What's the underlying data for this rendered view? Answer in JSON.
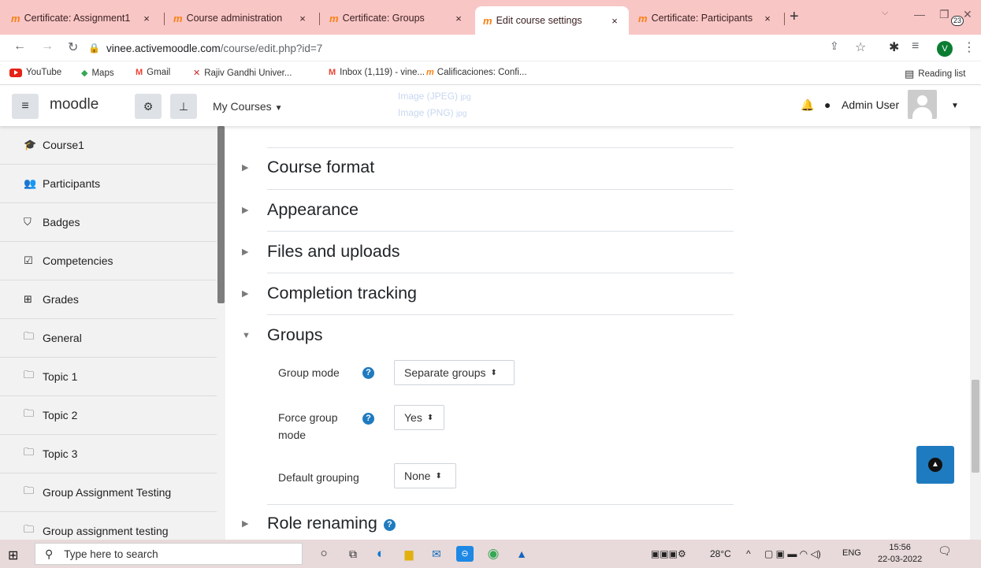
{
  "browser": {
    "tabs": [
      {
        "title": "Certificate: Assignment1"
      },
      {
        "title": "Course administration"
      },
      {
        "title": "Certificate: Groups"
      },
      {
        "title": "Edit course settings"
      },
      {
        "title": "Certificate: Participants"
      }
    ],
    "tab_close": "×",
    "new_tab": "+",
    "window": {
      "minimize": "—",
      "restore": "❐",
      "close": "✕"
    },
    "url_host": "vinee.activemoodle.com",
    "url_path": "/course/edit.php?id=7",
    "profile_initial": "V",
    "bookmarks": [
      "YouTube",
      "Maps",
      "Gmail",
      "Rajiv Gandhi Univer...",
      "Inbox (1,119) - vine...",
      "Calificaciones: Confi..."
    ],
    "reading_list": "Reading list"
  },
  "navbar": {
    "brand": "moodle",
    "my_courses": "My Courses",
    "user": "Admin User",
    "ghost_lines": [
      "Image (JPEG)",
      "Image (PNG)"
    ],
    "ghost_suffix": "jpg"
  },
  "drawer": {
    "items": [
      {
        "label": "Course1",
        "icon": "graduation-cap-icon"
      },
      {
        "label": "Participants",
        "icon": "users-icon"
      },
      {
        "label": "Badges",
        "icon": "shield-icon"
      },
      {
        "label": "Competencies",
        "icon": "checkbox-icon"
      },
      {
        "label": "Grades",
        "icon": "table-icon"
      },
      {
        "label": "General",
        "icon": "folder-icon"
      },
      {
        "label": "Topic 1",
        "icon": "folder-icon"
      },
      {
        "label": "Topic 2",
        "icon": "folder-icon"
      },
      {
        "label": "Topic 3",
        "icon": "folder-icon"
      },
      {
        "label": "Group Assignment Testing",
        "icon": "folder-icon"
      },
      {
        "label": "Group assignment testing",
        "icon": "folder-icon"
      }
    ]
  },
  "form": {
    "sections": {
      "course_format": "Course format",
      "appearance": "Appearance",
      "files": "Files and uploads",
      "completion": "Completion tracking",
      "groups": "Groups",
      "role_renaming": "Role renaming"
    },
    "groups": {
      "group_mode_label": "Group mode",
      "group_mode_value": "Separate groups",
      "force_label_1": "Force group",
      "force_label_2": "mode",
      "force_value": "Yes",
      "default_grouping_label": "Default grouping",
      "default_grouping_value": "None"
    },
    "help_glyph": "?"
  },
  "taskbar": {
    "search_placeholder": "Type here to search",
    "weather": "28°C",
    "language": "ENG",
    "time": "15:56",
    "date": "22-03-2022",
    "notifications": "23"
  },
  "colors": {
    "tabstrip": "#f9c6c6",
    "moodle_orange": "#f98012",
    "help_blue": "#1f7bc0",
    "drawer_bg": "#f2f2f2",
    "taskbar": "#e8d9da"
  }
}
